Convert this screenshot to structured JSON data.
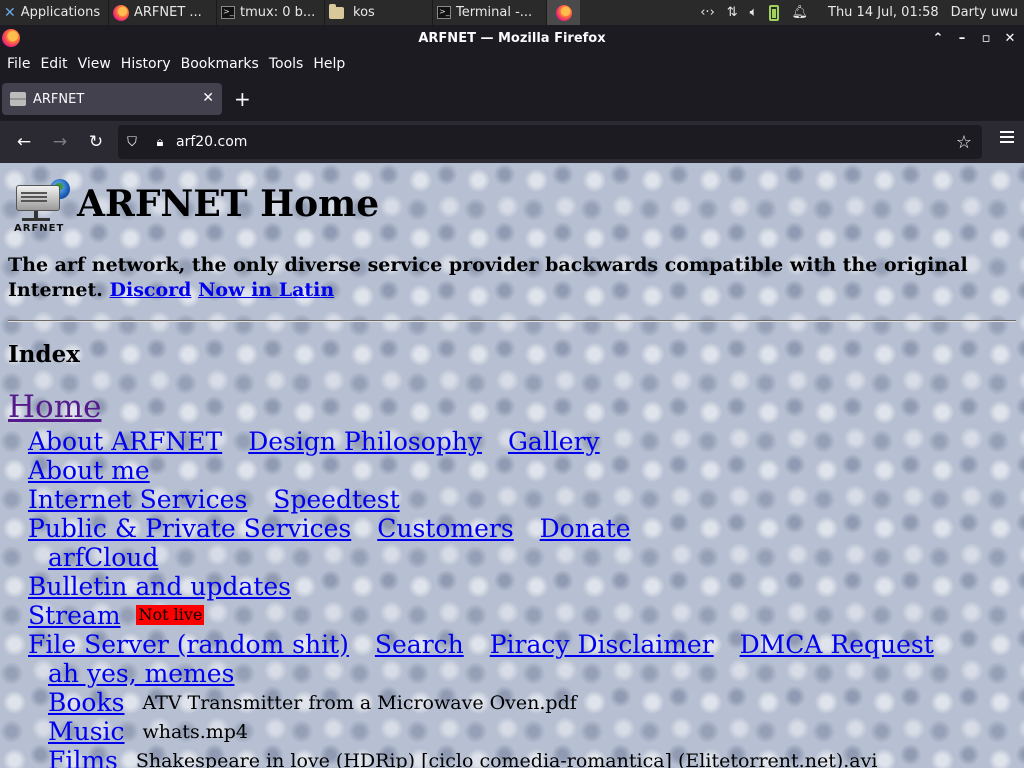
{
  "panel": {
    "apps_label": "Applications",
    "tasks": [
      {
        "label": "ARFNET ...",
        "icon": "firefox-icon"
      },
      {
        "label": "tmux: 0 b...",
        "icon": "terminal-icon"
      },
      {
        "label": "kos",
        "icon": "folder-icon"
      },
      {
        "label": "Terminal -...",
        "icon": "terminal-icon"
      }
    ],
    "clock": "Thu 14 Jul, 01:58",
    "user": "Darty uwu"
  },
  "window": {
    "title": "ARFNET — Mozilla Firefox"
  },
  "menu": [
    "File",
    "Edit",
    "View",
    "History",
    "Bookmarks",
    "Tools",
    "Help"
  ],
  "tabs": [
    {
      "label": "ARFNET"
    }
  ],
  "url": "arf20.com",
  "page": {
    "logo_text": "ARFNET",
    "heading": "ARFNET Home",
    "tagline": "The arf network, the only diverse service provider backwards compatible with the original Internet.",
    "tagline_links": [
      "Discord",
      "Now in Latin"
    ],
    "index_heading": "Index",
    "nav_home": "Home",
    "rows": [
      {
        "links": [
          "About ARFNET",
          "Design Philosophy",
          "Gallery"
        ]
      },
      {
        "links": [
          "About me"
        ]
      },
      {
        "links": [
          "Internet Services",
          "Speedtest"
        ]
      },
      {
        "links": [
          "Public & Private Services",
          "Customers",
          "Donate"
        ]
      },
      {
        "links": [
          "arfCloud"
        ]
      },
      {
        "links": [
          "Bulletin and updates"
        ]
      },
      {
        "links": [
          "Stream"
        ],
        "badge": "Not live"
      },
      {
        "links": [
          "File Server (random shit)",
          "Search",
          "Piracy Disclaimer",
          "DMCA Request"
        ]
      },
      {
        "links": [
          "ah yes, memes"
        ]
      },
      {
        "links": [
          "Books"
        ],
        "file": "ATV Transmitter from a Microwave Oven.pdf"
      },
      {
        "links": [
          "Music"
        ],
        "file": "whats.mp4"
      },
      {
        "links": [
          "Films"
        ],
        "file": "Shakespeare in love (HDRip) [ciclo comedia-romantica] (Elitetorrent.net).avi"
      }
    ]
  }
}
